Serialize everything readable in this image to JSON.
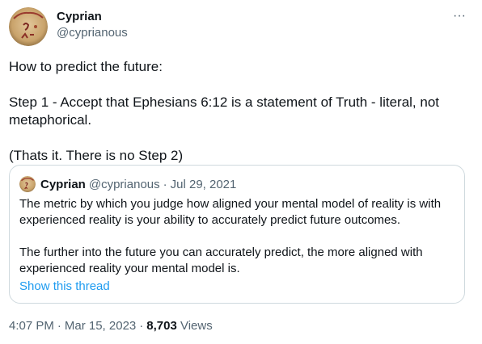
{
  "author": {
    "display_name": "Cyprian",
    "handle": "@cyprianous",
    "avatar_icon": "avatar-image"
  },
  "more_icon": "more-horizontal-icon",
  "more_label": "···",
  "tweet": {
    "paragraphs": [
      "How to predict the future:",
      "Step 1 - Accept that Ephesians 6:12 is a statement of Truth - literal, not metaphorical.",
      "(Thats it. There is no Step 2)"
    ]
  },
  "quote": {
    "display_name": "Cyprian",
    "handle": "@cyprianous",
    "separator": "·",
    "date": "Jul 29, 2021",
    "paragraphs": [
      "The metric by which you judge how aligned your mental model of reality is with experienced reality is your ability to accurately predict future outcomes.",
      "The further into the future you can accurately predict, the more aligned with experienced reality your mental model is."
    ],
    "show_thread_label": "Show this thread"
  },
  "meta": {
    "time": "4:07 PM",
    "separator": "·",
    "date": "Mar 15, 2023",
    "views_count": "8,703",
    "views_label": "Views"
  },
  "colors": {
    "text_primary": "#0f1419",
    "text_secondary": "#536471",
    "link": "#1d9bf0",
    "border": "#cfd9de"
  }
}
